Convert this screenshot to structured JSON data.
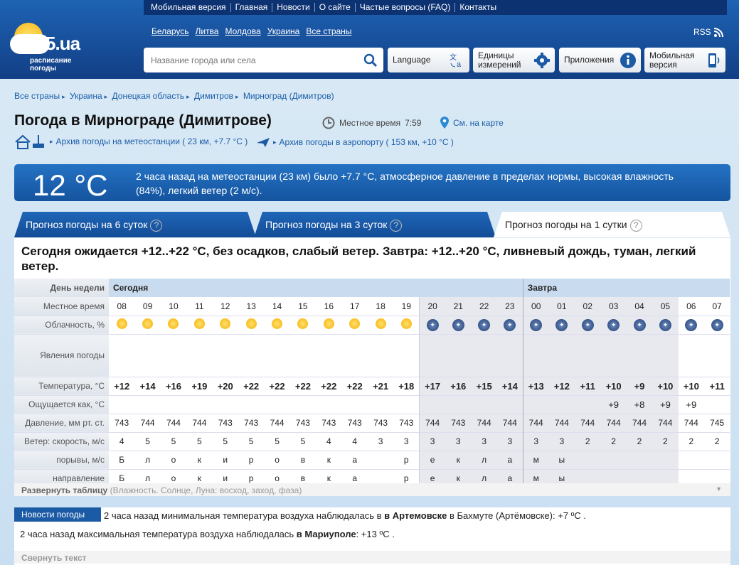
{
  "topnav": [
    "Мобильная версия",
    "Главная",
    "Новости",
    "О сайте",
    "Частые вопросы (FAQ)",
    "Контакты"
  ],
  "logo": {
    "brand": "rp5.ua",
    "sub1": "расписание",
    "sub2": "погоды"
  },
  "countries": [
    "Беларусь",
    "Литва",
    "Молдова",
    "Украина",
    "Все страны"
  ],
  "rss": "RSS",
  "search": {
    "placeholder": "Название города или села"
  },
  "buttons": {
    "language": "Language",
    "units1": "Единицы",
    "units2": "измерений",
    "apps": "Приложения",
    "mobile1": "Мобильная",
    "mobile2": "версия"
  },
  "breadcrumbs": [
    "Все страны",
    "Украина",
    "Донецкая область",
    "Димитров",
    "Мирноград (Димитров)"
  ],
  "title": "Погода в Мирнограде (Димитрове)",
  "local_time_label": "Местное время",
  "local_time": "7:59",
  "map_link": "См. на карте",
  "archive1": "Архив погоды на метеостанции ( 23 км, +7.7 °C )",
  "archive2": "Архив погоды в аэропорту ( 153 км, +10 °C )",
  "now": {
    "temp": "12 °C",
    "desc": "2 часа назад на метеостанции (23 км) было +7.7 °C, атмосферное давление в пределах нормы, высокая влажность (84%), легкий ветер (2 м/с)."
  },
  "tabs": [
    "Прогноз погоды на 6 суток",
    "Прогноз погоды на 3 суток",
    "Прогноз погоды на 1 сутки"
  ],
  "tab_help": "?",
  "summary": "Сегодня ожидается +12..+22 °С, без осадков, слабый ветер. Завтра: +12..+20 °С, ливневый дождь, туман, легкий ветер.",
  "table": {
    "labels": {
      "day": "День недели",
      "time": "Местное время",
      "cloud": "Облачность, %",
      "phen": "Явления погоды",
      "temp": "Температура, °C",
      "feels": "Ощущается как, °C",
      "pressure": "Давление, мм рт. ст.",
      "wind": "Ветер: скорость, м/с",
      "gusts": "порывы, м/с",
      "dir": "направление"
    },
    "today": "Сегодня",
    "tomorrow": "Завтра",
    "hours": [
      "08",
      "09",
      "10",
      "11",
      "12",
      "13",
      "14",
      "15",
      "16",
      "17",
      "18",
      "19",
      "20",
      "21",
      "22",
      "23",
      "00",
      "01",
      "02",
      "03",
      "04",
      "05",
      "06",
      "07"
    ],
    "temps": [
      "+12",
      "+14",
      "+16",
      "+19",
      "+20",
      "+22",
      "+22",
      "+22",
      "+22",
      "+22",
      "+21",
      "+18",
      "+17",
      "+16",
      "+15",
      "+14",
      "+13",
      "+12",
      "+11",
      "+10",
      "+9",
      "+10",
      "+10",
      "+11"
    ],
    "feels": [
      "",
      "",
      "",
      "",
      "",
      "",
      "",
      "",
      "",
      "",
      "",
      "",
      "",
      "",
      "",
      "",
      "",
      "",
      "",
      "+9",
      "+8",
      "+9",
      "+9",
      ""
    ],
    "pressure": [
      "743",
      "744",
      "744",
      "744",
      "743",
      "743",
      "744",
      "743",
      "743",
      "743",
      "743",
      "743",
      "744",
      "743",
      "744",
      "744",
      "744",
      "744",
      "744",
      "744",
      "744",
      "744",
      "744",
      "745"
    ],
    "wind": [
      "4",
      "5",
      "5",
      "5",
      "5",
      "5",
      "5",
      "5",
      "4",
      "4",
      "3",
      "3",
      "3",
      "3",
      "3",
      "3",
      "3",
      "3",
      "2",
      "2",
      "2",
      "2",
      "2",
      "2"
    ],
    "gusts": [
      "Б",
      "л",
      "о",
      "к",
      "и",
      "р",
      "о",
      "в",
      "к",
      "а",
      "",
      "р",
      "е",
      "к",
      "л",
      "а",
      "м",
      "ы",
      "",
      "",
      "",
      "",
      "",
      ""
    ],
    "dirs": [
      "Б",
      "л",
      "о",
      "к",
      "и",
      "р",
      "о",
      "в",
      "к",
      "а",
      "",
      "р",
      "е",
      "к",
      "л",
      "а",
      "м",
      "ы",
      "",
      "",
      "",
      "",
      "",
      ""
    ]
  },
  "expand": {
    "bold": "Развернуть таблицу",
    "rest": " (Влажность. Солнце, Луна: восход, заход, фаза)"
  },
  "news": {
    "tag": "Новости погоды",
    "n1a": "2 часа назад минимальная температура воздуха наблюдалась в ",
    "n1b": "в Артемовске",
    "n1c": " в Бахмуте (Артёмовске): +7 ºC .",
    "n2a": "2 часа назад максимальная температура воздуха наблюдалась ",
    "n2b": "в Мариуполе",
    "n2c": ": +13 ºC .",
    "collapse": "Свернуть текст"
  },
  "colors": {
    "accent": "#1b5aa5",
    "temp": "#e8640c"
  }
}
